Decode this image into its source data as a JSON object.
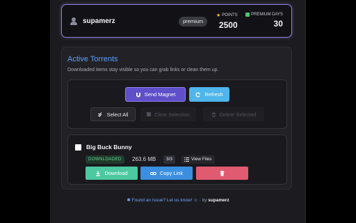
{
  "profile": {
    "username": "supamerz",
    "badge": "premium",
    "points_label": "POINTS",
    "points_value": "2500",
    "days_label": "PREMIUM DAYS",
    "days_value": "30"
  },
  "torrents_section": {
    "title": "Active Torrents",
    "description": "Downloaded items stay visible so you can grab links or clean them up.",
    "send_magnet_label": "Send Magnet",
    "refresh_label": "Refresh",
    "select_all_label": "Select All",
    "clear_selection_label": "Clear Selection",
    "delete_selected_label": "Delete Selected"
  },
  "torrents": [
    {
      "name": "Big Buck Bunny",
      "status": "DOWNLOADED",
      "size": "263.6 MB",
      "files": "3/3",
      "view_files_label": "View Files",
      "download_label": "Download",
      "copy_link_label": "Copy Link"
    }
  ],
  "footer": {
    "issue_text": "Found an Issue? Let us know!",
    "by_text": "by",
    "author": "supamerz"
  },
  "colors": {
    "accent": "#5b9fff",
    "magnet_button": "#5f4fc9",
    "refresh_button": "#4fb5ea",
    "download_button": "#4cc9a0",
    "copy_button": "#3a8fe0",
    "delete_button": "#e05a70"
  },
  "icons": {
    "avatar": "user-icon",
    "points": "star-icon",
    "premium_days": "calendar-icon",
    "send_magnet": "magnet-icon",
    "refresh": "refresh-icon",
    "select_all": "check-double-icon",
    "clear_selection": "square-icon",
    "delete_selected": "trash-icon",
    "view_files": "list-icon",
    "download": "download-icon",
    "copy_link": "link-icon",
    "delete": "trash-icon",
    "footer_issue": "bug-icon"
  }
}
